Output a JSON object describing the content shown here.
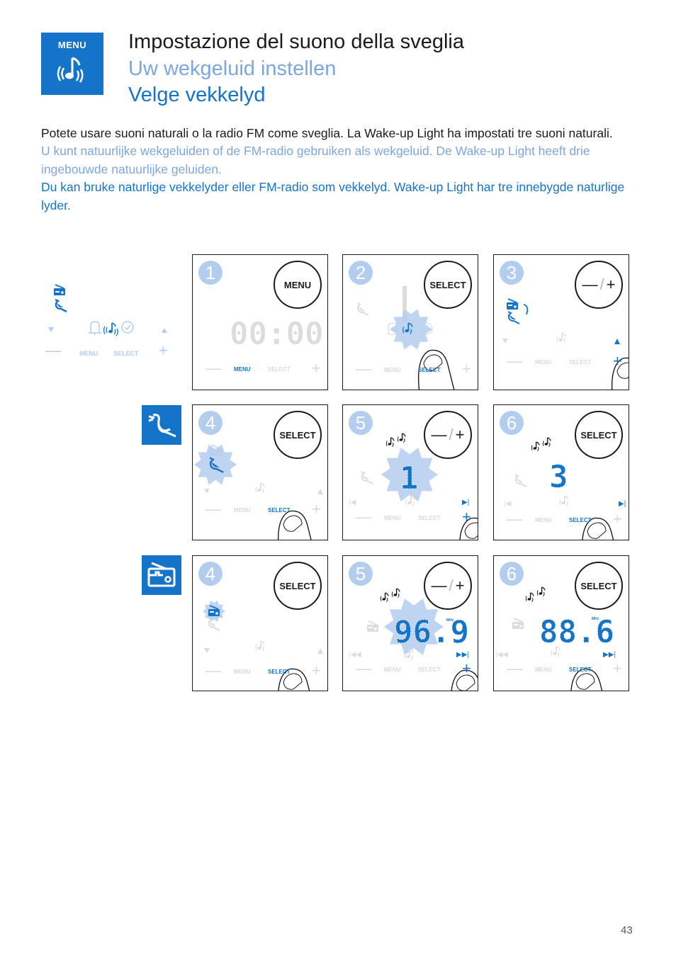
{
  "header": {
    "menu_badge_label": "MENU",
    "menu_badge_icon": "alarm-sound-note-icon",
    "title_it": "Impostazione del suono della sveglia",
    "title_nl": "Uw wekgeluid instellen",
    "title_no": "Velge vekkelyd"
  },
  "intro": {
    "it": "Potete usare suoni naturali o la radio FM come sveglia. La Wake-up Light ha impostati tre suoni naturali.",
    "nl": "U kunt natuurlijke wekgeluiden of de FM-radio gebruiken als wekgeluid. De Wake-up Light heeft drie ingebouwde natuurlijke geluiden.",
    "no": "Du kan bruke naturlige vekkelyder eller FM-radio som vekkelyd. Wake-up Light har tre innebygde naturlige lyder."
  },
  "legend": {
    "icons": [
      "radio-icon",
      "bird-icon",
      "down-arrow-icon",
      "bell-icon",
      "sound-note-icon",
      "clock-icon",
      "up-arrow-icon"
    ],
    "minus": "—",
    "menu": "MENU",
    "select": "SELECT",
    "plus": "+"
  },
  "side_badges": [
    {
      "icon": "bird-icon"
    },
    {
      "icon": "radio-icon"
    }
  ],
  "colors": {
    "accent": "#1574c8",
    "light_accent": "#7da7dc",
    "step_circle": "#b3cdee",
    "inactive": "#d8d8d8",
    "text": "#1b1b1b"
  },
  "panels": [
    {
      "step": "1",
      "button": "MENU",
      "display": "00:00",
      "bar_menu": "MENU",
      "bar_select": "SELECT",
      "active": "menu"
    },
    {
      "step": "2",
      "button": "SELECT",
      "display": "",
      "bar_menu": "MENU",
      "bar_select": "SELECT",
      "active": "select"
    },
    {
      "step": "3",
      "button": "—/+",
      "display": "",
      "bar_menu": "MENU",
      "bar_select": "SELECT",
      "active": "plus"
    },
    {
      "step": "4",
      "button": "SELECT",
      "display": "",
      "bar_menu": "MENU",
      "bar_select": "SELECT",
      "active": "select"
    },
    {
      "step": "5",
      "button": "—/+",
      "display": "1",
      "bar_menu": "MENU",
      "bar_select": "SELECT",
      "active": "plus"
    },
    {
      "step": "6",
      "button": "SELECT",
      "display": "3",
      "bar_menu": "MENU",
      "bar_select": "SELECT",
      "active": "select"
    },
    {
      "step": "4",
      "button": "SELECT",
      "display": "",
      "bar_menu": "MENU",
      "bar_select": "SELECT",
      "active": "select"
    },
    {
      "step": "5",
      "button": "—/+",
      "display": "96.9",
      "unit": "MHz",
      "bar_menu": "MENU",
      "bar_select": "SELECT",
      "active": "plus"
    },
    {
      "step": "6",
      "button": "SELECT",
      "display": "88.6",
      "unit": "MHz",
      "bar_menu": "MENU",
      "bar_select": "SELECT",
      "active": "select"
    }
  ],
  "btn_pm": {
    "minus": "—",
    "slash": "/",
    "plus": "+"
  },
  "page_number": "43"
}
